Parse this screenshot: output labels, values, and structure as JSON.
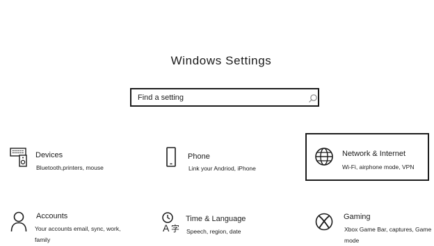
{
  "header": {
    "title": "Windows Settings"
  },
  "search": {
    "placeholder": "Find a setting"
  },
  "tiles": [
    {
      "name": "Devices",
      "description": "Bluetooth,printers, mouse",
      "icon": "devices-icon"
    },
    {
      "name": "Phone",
      "description": "Link your Andriod, iPhone",
      "icon": "phone-icon"
    },
    {
      "name": "Network & Internet",
      "description": "Wi-Fi, airphone mode, VPN",
      "icon": "globe-icon"
    },
    {
      "name": "Accounts",
      "description": "Your accounts email, sync, work, family",
      "icon": "person-icon"
    },
    {
      "name": "Time & Language",
      "description": "Speech, region, date",
      "icon": "time-language-icon"
    },
    {
      "name": "Gaming",
      "description": "Xbox Game Bar, captures, Game mode",
      "icon": "xbox-icon"
    }
  ],
  "colors": {
    "ink": "#1a1a1a",
    "background": "#ffffff"
  }
}
